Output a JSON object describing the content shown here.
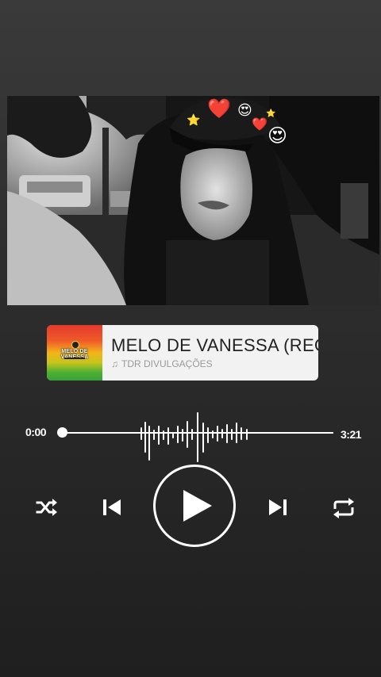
{
  "song": {
    "cover_text": "MELO DE VANESSA",
    "title": "MELO DE VANESSA (REGGAE",
    "artist_icon": "music-note-icon",
    "artist": "TDR DIVULGAÇÕES"
  },
  "progress": {
    "elapsed": "0:00",
    "duration": "3:21",
    "position_fraction": 0.0
  },
  "controls": {
    "shuffle": "shuffle-icon",
    "previous": "skip-previous-icon",
    "play": "play-icon",
    "next": "skip-next-icon",
    "repeat": "repeat-icon"
  },
  "photo": {
    "description_icon": "photo",
    "stickers": [
      "heart-emoji",
      "heart-eyes-emoji",
      "star-emoji"
    ]
  },
  "colors": {
    "background_top": "#3a3a3a",
    "background_bottom": "#1f1f1f",
    "card_bg": "#f2f2f2",
    "title_color": "#222222",
    "artist_color": "#9a9a9a",
    "foreground": "#ffffff"
  }
}
